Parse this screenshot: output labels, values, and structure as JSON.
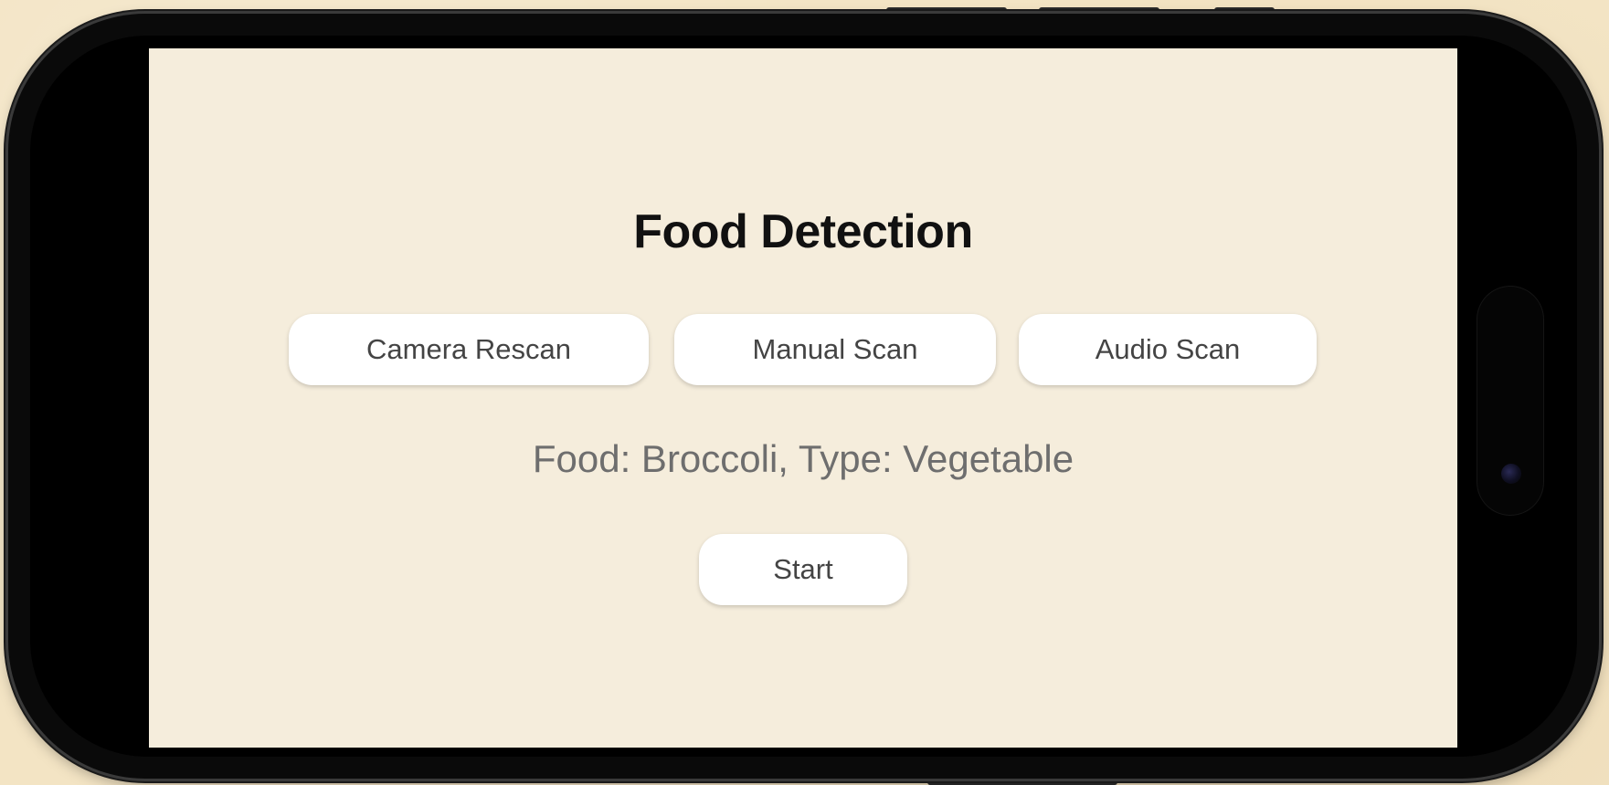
{
  "app": {
    "title": "Food Detection"
  },
  "scan_buttons": {
    "camera_rescan": "Camera Rescan",
    "manual_scan": "Manual Scan",
    "audio_scan": "Audio Scan"
  },
  "result": {
    "text": "Food: Broccoli, Type: Vegetable"
  },
  "start_button": {
    "label": "Start"
  },
  "colors": {
    "screen_background": "#f5eddc",
    "button_background": "#ffffff",
    "title_text": "#111111",
    "result_text": "#6e6e6e"
  }
}
